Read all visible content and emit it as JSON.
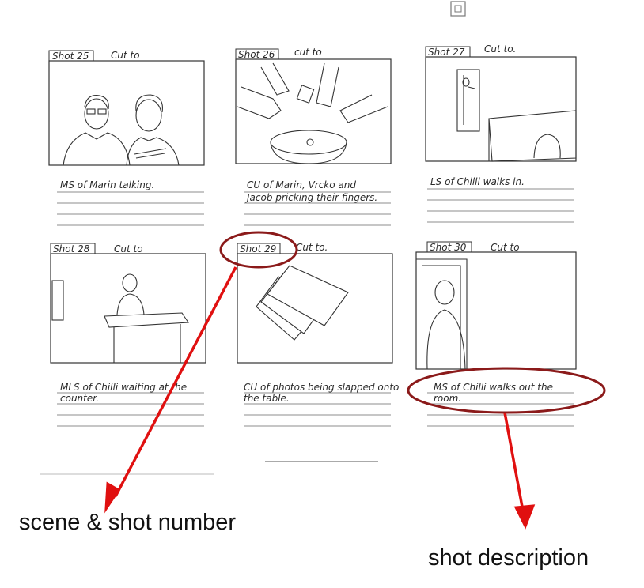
{
  "panels": [
    {
      "shot": "Shot 25",
      "transition": "Cut to",
      "description": [
        "MS of Marin talking."
      ]
    },
    {
      "shot": "Shot 26",
      "transition": "cut to",
      "description": [
        "CU of Marin, Vrcko and",
        "Jacob pricking their fingers."
      ]
    },
    {
      "shot": "Shot 27",
      "transition": "Cut to.",
      "description": [
        "LS of Chilli walks in."
      ]
    },
    {
      "shot": "Shot 28",
      "transition": "Cut to",
      "description": [
        "MLS of Chilli waiting at the",
        "counter."
      ]
    },
    {
      "shot": "Shot 29",
      "transition": "Cut to.",
      "description": [
        "CU of photos being slapped onto",
        "the table."
      ]
    },
    {
      "shot": "Shot 30",
      "transition": "Cut to",
      "description": [
        "MS of Chilli walks out the",
        "room."
      ]
    }
  ],
  "annotations": {
    "shot_number_label": "scene & shot number",
    "description_label": "shot description",
    "highlight_color": "#8b1a1a",
    "arrow_color": "#e01010"
  }
}
